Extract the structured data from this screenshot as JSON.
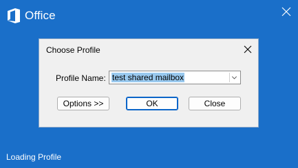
{
  "splash": {
    "brand": "Office",
    "status": "Loading Profile",
    "icons": {
      "logo": "office-logo-icon",
      "close": "close-icon"
    },
    "colors": {
      "background": "#1a6fc9",
      "text": "#ffffff"
    }
  },
  "dialog": {
    "title": "Choose Profile",
    "profile_label": "Profile Name:",
    "profile_value": "test shared mailbox",
    "buttons": {
      "options": "Options >>",
      "ok": "OK",
      "close": "Close"
    },
    "colors": {
      "selection": "#99c9ef",
      "default_button_border": "#0a64c8"
    }
  }
}
